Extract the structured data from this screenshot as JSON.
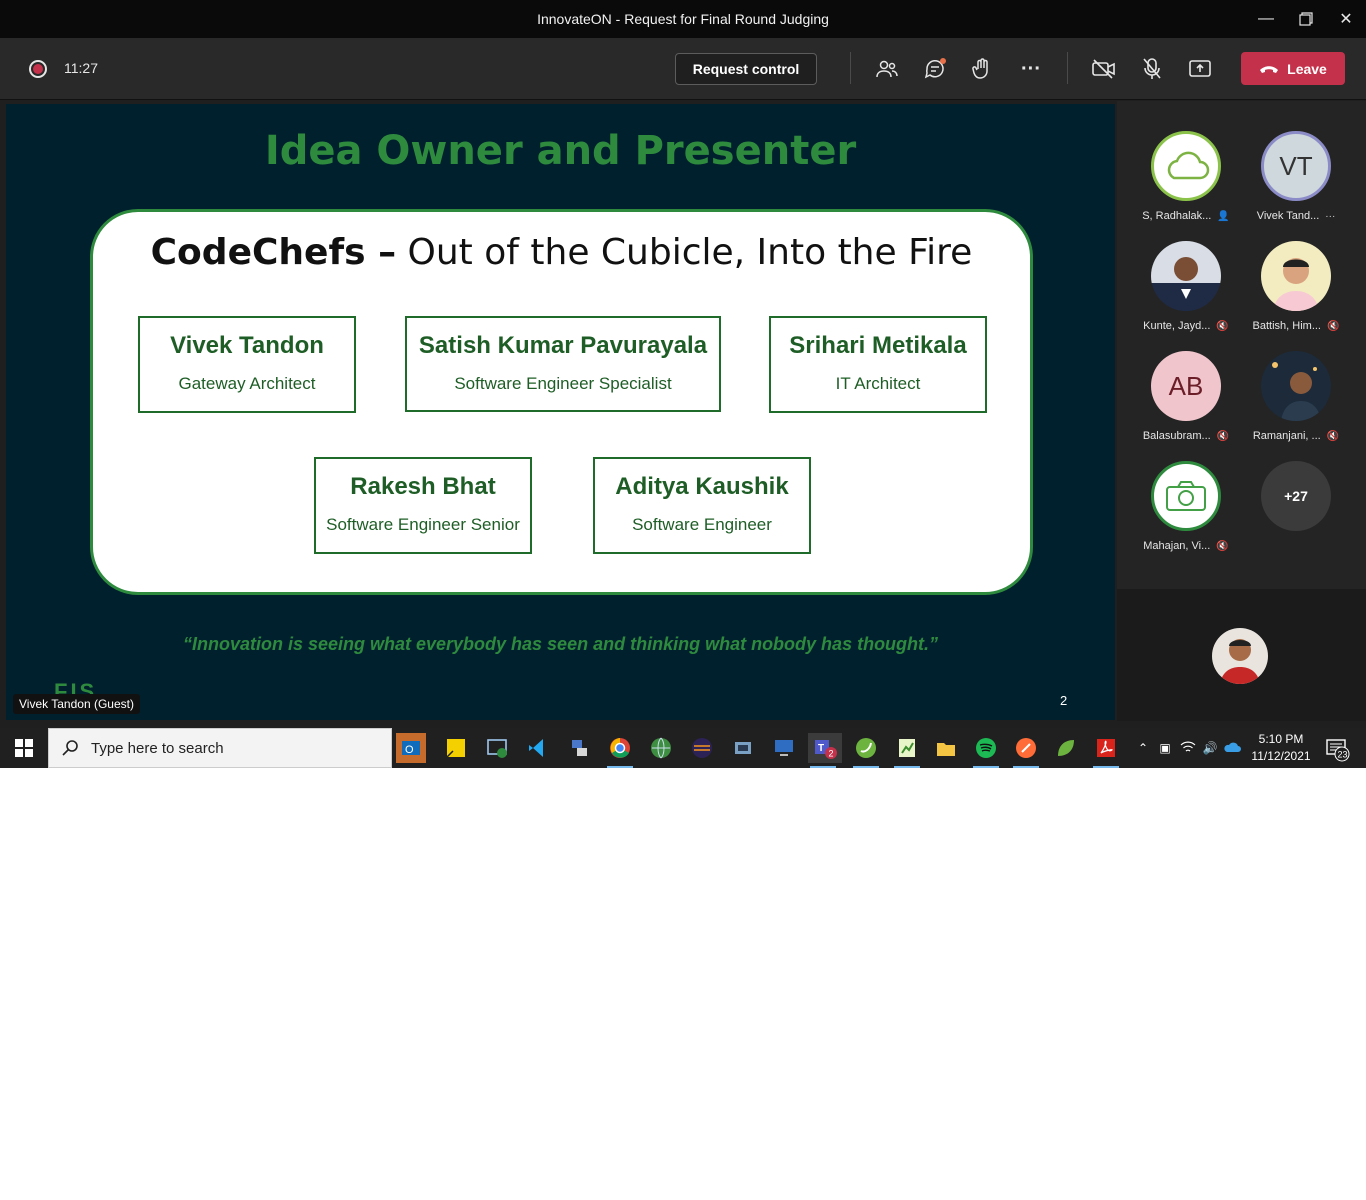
{
  "window": {
    "title": "InnovateON - Request for Final Round Judging"
  },
  "toolbar": {
    "time": "11:27",
    "request_control": "Request control",
    "leave": "Leave"
  },
  "slide": {
    "title": "Idea Owner and Presenter",
    "team_name": "CodeChefs –",
    "tagline": "Out of the Cubicle, Into the Fire",
    "members": [
      {
        "name": "Vivek Tandon",
        "role": "Gateway Architect"
      },
      {
        "name": "Satish Kumar Pavurayala",
        "role": "Software Engineer Specialist"
      },
      {
        "name": "Srihari Metikala",
        "role": "IT Architect"
      },
      {
        "name": "Rakesh Bhat",
        "role": "Software Engineer Senior"
      },
      {
        "name": "Aditya Kaushik",
        "role": "Software Engineer"
      }
    ],
    "quote": "“Innovation is seeing what everybody has seen and thinking what nobody has thought.”",
    "page_number": "2",
    "logo_text": "FIS"
  },
  "presenter_label": "Vivek Tandon (Guest)",
  "participants": [
    {
      "name": "S, Radhalak...",
      "initials": "",
      "avatar": "cloud-icon"
    },
    {
      "name": "Vivek Tand...",
      "initials": "VT",
      "avatar": "initials"
    },
    {
      "name": "Kunte, Jayd...",
      "initials": "",
      "avatar": "photo"
    },
    {
      "name": "Battish, Him...",
      "initials": "",
      "avatar": "photo"
    },
    {
      "name": "Balasubram...",
      "initials": "AB",
      "avatar": "initials"
    },
    {
      "name": "Ramanjani, ...",
      "initials": "",
      "avatar": "photo"
    },
    {
      "name": "Mahajan, Vi...",
      "initials": "",
      "avatar": "camera-icon"
    },
    {
      "name": "+27",
      "initials": "+27",
      "avatar": "overflow"
    }
  ],
  "taskbar": {
    "search_placeholder": "Type here to search",
    "time": "5:10 PM",
    "date": "11/12/2021",
    "notification_count": "23",
    "teams_badge": "2"
  },
  "colors": {
    "leave": "#c4314b",
    "slide_bg": "#01202e",
    "accent_green": "#2e8b3e",
    "avatar_ring": "#8b8cc7"
  }
}
